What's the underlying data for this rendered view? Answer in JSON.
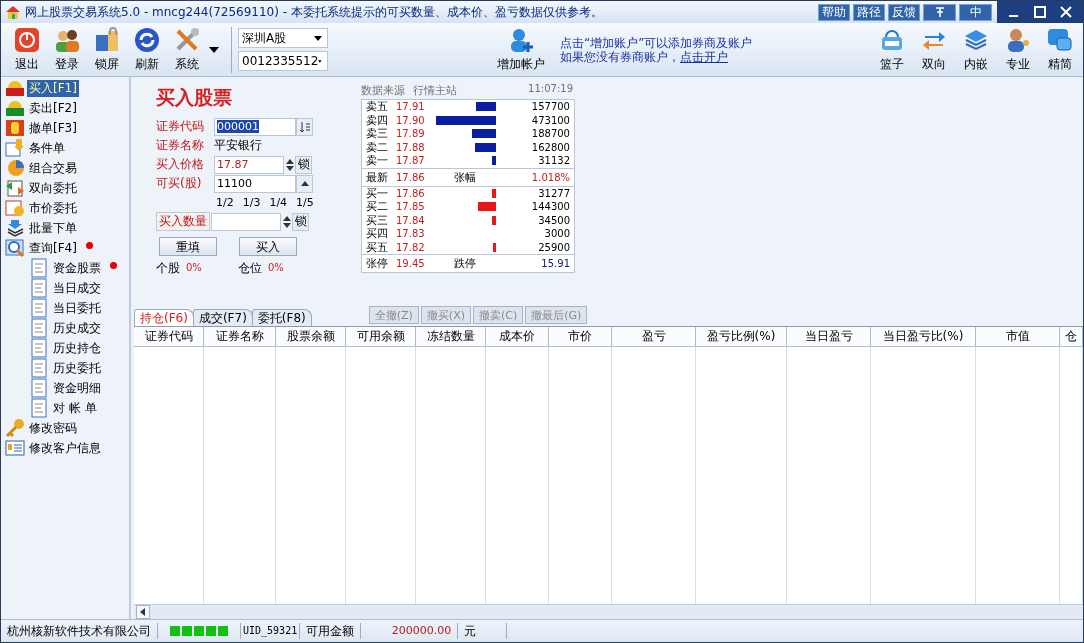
{
  "window": {
    "title": "网上股票交易系统5.0 - mncg244(72569110) - 本委托系统提示的可买数量、成本价、盈亏数据仅供参考。",
    "buttons": [
      "帮助",
      "路径",
      "反馈"
    ],
    "lang_button": "中"
  },
  "toolbar": {
    "left": [
      {
        "label": "退出"
      },
      {
        "label": "登录"
      },
      {
        "label": "锁屏"
      },
      {
        "label": "刷新"
      },
      {
        "label": "系统"
      }
    ],
    "market": "深圳A股",
    "account": "0012335512",
    "add_account": "增加帐户",
    "notice": "点击“增加账户”可以添加券商及账户",
    "notice_prefix": "如果您没有券商账户，",
    "notice_link": "点击开户",
    "right": [
      {
        "label": "篮子"
      },
      {
        "label": "双向"
      },
      {
        "label": "内嵌"
      },
      {
        "label": "专业"
      },
      {
        "label": "精简"
      }
    ]
  },
  "sidebar": {
    "items": [
      {
        "label": "买入[F1]",
        "selected": true,
        "alert": false
      },
      {
        "label": "卖出[F2]",
        "selected": false,
        "alert": false
      },
      {
        "label": "撤单[F3]",
        "selected": false,
        "alert": false
      },
      {
        "label": "条件单",
        "selected": false,
        "alert": false
      },
      {
        "label": "组合交易",
        "selected": false,
        "alert": false
      },
      {
        "label": "双向委托",
        "selected": false,
        "alert": false
      },
      {
        "label": "市价委托",
        "selected": false,
        "alert": false
      },
      {
        "label": "批量下单",
        "selected": false,
        "alert": false
      },
      {
        "label": "查询[F4]",
        "selected": false,
        "alert": true,
        "children": [
          {
            "label": "资金股票",
            "selected": false,
            "alert": true
          },
          {
            "label": "当日成交",
            "selected": false,
            "alert": false
          },
          {
            "label": "当日委托",
            "selected": false,
            "alert": false
          },
          {
            "label": "历史成交",
            "selected": false,
            "alert": false
          },
          {
            "label": "历史持仓",
            "selected": false,
            "alert": false
          },
          {
            "label": "历史委托",
            "selected": false,
            "alert": false
          },
          {
            "label": "资金明细",
            "selected": false,
            "alert": false
          },
          {
            "label": "对 帐 单",
            "selected": false,
            "alert": false
          }
        ]
      },
      {
        "label": "修改密码",
        "selected": false,
        "alert": false
      },
      {
        "label": "修改客户信息",
        "selected": false,
        "alert": false
      }
    ]
  },
  "order_form": {
    "title": "买入股票",
    "code_label": "证券代码",
    "code": "000001",
    "name_label": "证券名称",
    "name": "平安银行",
    "price_label": "买入价格",
    "price": "17.87",
    "lock": "锁",
    "avail_label": "可买(股)",
    "avail": "11100",
    "fractions": [
      "1/2",
      "1/3",
      "1/4",
      "1/5"
    ],
    "qty_label": "买入数量",
    "qty_lock": "锁",
    "buttons": [
      "重填",
      "买入"
    ],
    "stats": [
      {
        "label": "个股",
        "value": "0%"
      },
      {
        "label": "仓位",
        "value": "0%"
      }
    ]
  },
  "quote": {
    "source_label": "数据来源",
    "source": "行情主站",
    "time": "11:07:19",
    "asks": [
      {
        "label": "卖五",
        "price": "17.91",
        "volume": "157700"
      },
      {
        "label": "卖四",
        "price": "17.90",
        "volume": "473100"
      },
      {
        "label": "卖三",
        "price": "17.89",
        "volume": "188700"
      },
      {
        "label": "卖二",
        "price": "17.88",
        "volume": "162800"
      },
      {
        "label": "卖一",
        "price": "17.87",
        "volume": "31132"
      }
    ],
    "latest": {
      "label": "最新",
      "price": "17.86",
      "change_label": "张幅",
      "change": "1.018%"
    },
    "bids": [
      {
        "label": "买一",
        "price": "17.86",
        "volume": "31277"
      },
      {
        "label": "买二",
        "price": "17.85",
        "volume": "144300"
      },
      {
        "label": "买三",
        "price": "17.84",
        "volume": "34500"
      },
      {
        "label": "买四",
        "price": "17.83",
        "volume": "3000"
      },
      {
        "label": "买五",
        "price": "17.82",
        "volume": "25900"
      }
    ],
    "limits": {
      "up_label": "张停",
      "up": "19.45",
      "down_label": "跌停",
      "down": "15.91"
    }
  },
  "tabs": [
    {
      "label": "持仓(F6)",
      "selected": true
    },
    {
      "label": "成交(F7)",
      "selected": false
    },
    {
      "label": "委托(F8)",
      "selected": false
    }
  ],
  "actions": [
    {
      "label": "全撤(Z)",
      "disabled": true
    },
    {
      "label": "撤买(X)",
      "disabled": true
    },
    {
      "label": "撤卖(C)",
      "disabled": true
    },
    {
      "label": "撤最后(G)",
      "disabled": true
    }
  ],
  "table": {
    "columns": [
      "证券代码",
      "证券名称",
      "股票余额",
      "可用余额",
      "冻结数量",
      "成本价",
      "市价",
      "盈亏",
      "盈亏比例(%)",
      "当日盈亏",
      "当日盈亏比(%)",
      "市值",
      "仓"
    ]
  },
  "status_bar": {
    "company": "杭州核新软件技术有限公司",
    "uid": "UID_59321",
    "funds_label": "可用金额",
    "funds": "200000.00",
    "unit": "元"
  }
}
